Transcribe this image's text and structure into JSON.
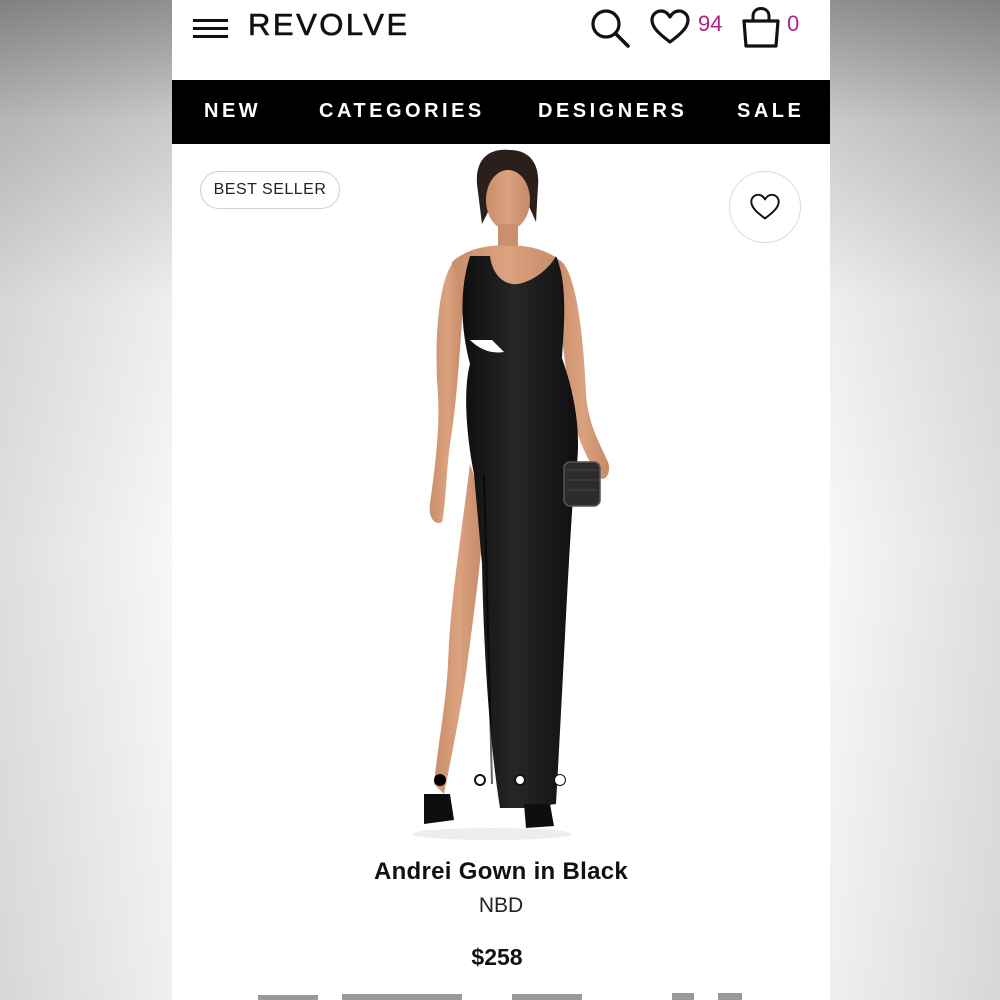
{
  "app": {
    "logo": "REVOLVE",
    "brand_accent": "#b0208a"
  },
  "header": {
    "menu_icon": "hamburger-menu-icon",
    "search_icon": "search-icon",
    "favorites_icon": "heart-icon",
    "favorites_count": "94",
    "bag_icon": "shopping-bag-icon",
    "bag_count": "0"
  },
  "nav": {
    "items": [
      {
        "label": "NEW"
      },
      {
        "label": "CATEGORIES"
      },
      {
        "label": "DESIGNERS"
      },
      {
        "label": "SALE"
      }
    ]
  },
  "product": {
    "badge": "BEST SELLER",
    "wishlist_icon": "heart-outline-icon",
    "name": "Andrei Gown in Black",
    "brand": "NBD",
    "price": "$258",
    "dress_color": "#151515",
    "carousel": {
      "total": 4,
      "active_index": 0
    }
  }
}
